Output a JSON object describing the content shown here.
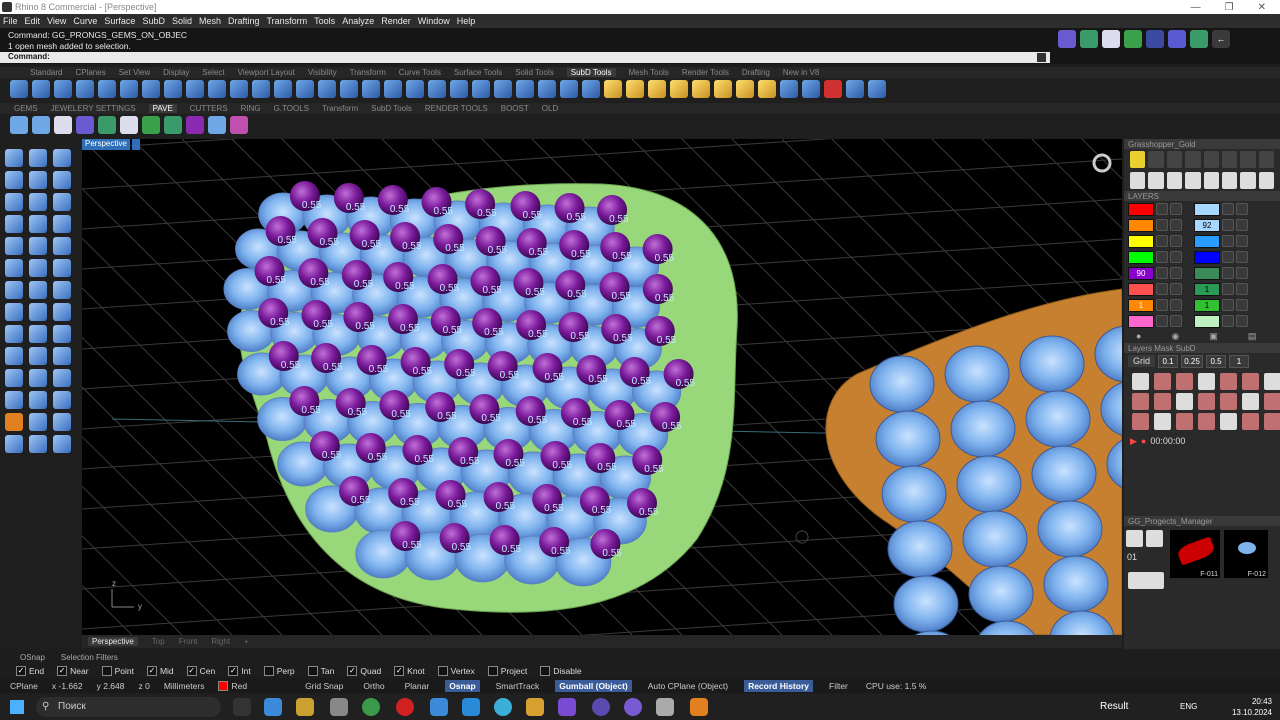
{
  "window": {
    "title": "Rhino 8 Commercial - [Perspective]"
  },
  "menu": [
    "File",
    "Edit",
    "View",
    "Curve",
    "Surface",
    "SubD",
    "Solid",
    "Mesh",
    "Drafting",
    "Transform",
    "Tools",
    "Analyze",
    "Render",
    "Window",
    "Help"
  ],
  "command": {
    "history": [
      "Command: GG_PRONGS_GEMS_ON_OBJEC",
      "1 open mesh added to selection."
    ],
    "prompt": "Command:"
  },
  "toolbar_tabs_1": [
    "Standard",
    "CPlanes",
    "Set View",
    "Display",
    "Select",
    "Viewport Layout",
    "Visibility",
    "Transform",
    "Curve Tools",
    "Surface Tools",
    "Solid Tools",
    "SubD Tools",
    "Mesh Tools",
    "Render Tools",
    "Drafting",
    "New in V8"
  ],
  "toolbar_tabs_1_active": "SubD Tools",
  "toolbar_tabs_2": [
    "GEMS",
    "JEWELERY SETTINGS",
    "PAVE",
    "CUTTERS",
    "RING",
    "G.TOOLS",
    "Transform",
    "SubD Tools",
    "RENDER TOOLS",
    "BOOST",
    "OLD"
  ],
  "toolbar_tabs_2_active": "PAVE",
  "viewport": {
    "name": "Perspective",
    "axis_z": "z",
    "axis_y": "y",
    "prong_label": "0.55"
  },
  "viewport_tabs": [
    "Perspective",
    "Top",
    "Front",
    "Right",
    "+"
  ],
  "panels": {
    "grasshopper": "Grasshopper_Gold",
    "layers": "LAYERS",
    "layers_mask": "Layers Mask SubD",
    "grid_label": "Grid",
    "grid_values": [
      "0.1",
      "0.25",
      "0.5",
      "1"
    ],
    "timer": "00:00:00",
    "projects": "GG_Progects_Manager",
    "project_no": "01",
    "project_ids": [
      "F-011",
      "F-012"
    ]
  },
  "layer_rows": [
    {
      "left": "#ff0000",
      "left_text": "",
      "right": "#a8d8ff",
      "right_text": ""
    },
    {
      "left": "#ff8800",
      "left_text": "",
      "right": "#a8d8ff",
      "right_text": "92"
    },
    {
      "left": "#ffff00",
      "left_text": "",
      "right": "#2a9bff",
      "right_text": ""
    },
    {
      "left": "#00ff00",
      "left_text": "",
      "right": "#0000ff",
      "right_text": ""
    },
    {
      "left": "#8800cc",
      "left_text": "90",
      "right": "#3a8a5a",
      "right_text": ""
    },
    {
      "left": "#ff5050",
      "left_text": "",
      "right": "#2a9b55",
      "right_text": "1"
    },
    {
      "left": "#ff8800",
      "left_text": "1",
      "right": "#30c030",
      "right_text": "1"
    },
    {
      "left": "#ff66cc",
      "left_text": "",
      "right": "#bff0bf",
      "right_text": ""
    }
  ],
  "osnap_tabs": [
    "OSnap",
    "Selection Filters"
  ],
  "osnap": [
    {
      "label": "End",
      "checked": true
    },
    {
      "label": "Near",
      "checked": true
    },
    {
      "label": "Point",
      "checked": false
    },
    {
      "label": "Mid",
      "checked": true
    },
    {
      "label": "Cen",
      "checked": true
    },
    {
      "label": "Int",
      "checked": true
    },
    {
      "label": "Perp",
      "checked": false
    },
    {
      "label": "Tan",
      "checked": false
    },
    {
      "label": "Quad",
      "checked": true
    },
    {
      "label": "Knot",
      "checked": true
    },
    {
      "label": "Vertex",
      "checked": false
    },
    {
      "label": "Project",
      "checked": false
    },
    {
      "label": "Disable",
      "checked": false
    }
  ],
  "status": {
    "cplane": "CPlane",
    "x": "x -1.662",
    "y": "y 2.648",
    "z": "z 0",
    "units": "Millimeters",
    "layer": "Red",
    "layer_color": "#ff0000",
    "toggles": [
      "Grid Snap",
      "Ortho",
      "Planar",
      "Osnap",
      "SmartTrack",
      "Gumball (Object)",
      "Auto CPlane (Object)",
      "Record History",
      "Filter"
    ],
    "toggles_on": [
      "Osnap",
      "Gumball (Object)",
      "Record History"
    ],
    "cpu": "CPU use: 1.5 %"
  },
  "taskbar": {
    "search": "Поиск",
    "result": "Result",
    "lang": "ENG",
    "time": "20:43",
    "date": "13.10.2024"
  }
}
